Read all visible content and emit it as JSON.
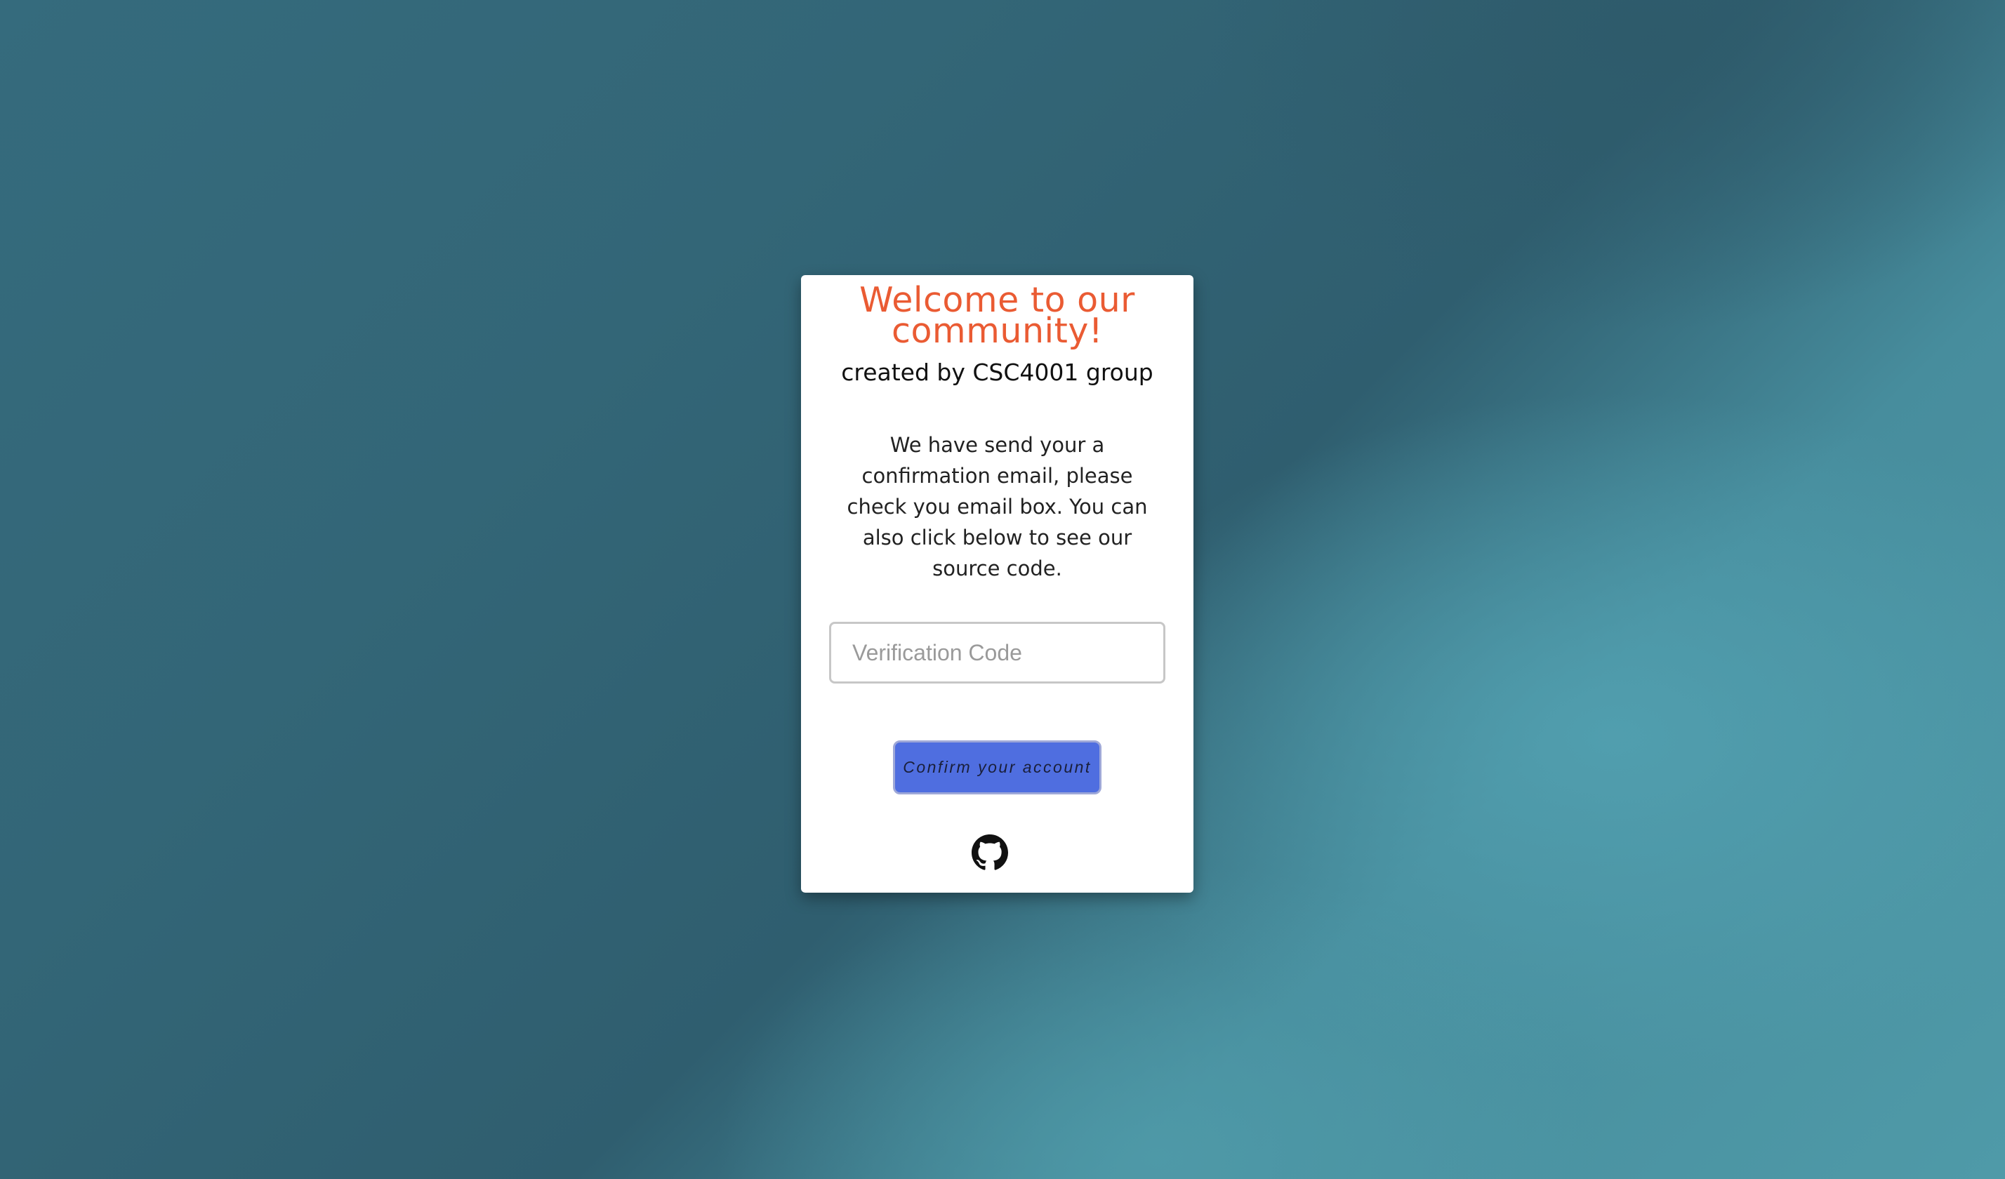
{
  "card": {
    "title": "Welcome to our community!",
    "subtitle": "created by CSC4001 group",
    "message": "We have send your a confirmation email, please check you email box. You can also click below to see our source code."
  },
  "form": {
    "verification_placeholder": "Verification Code",
    "verification_value": "",
    "confirm_label": "Confirm your account"
  },
  "footer": {
    "link_icon": "github-icon"
  },
  "colors": {
    "title": "#ea5b33",
    "button": "#4f6ee0",
    "card": "#ffffff"
  }
}
